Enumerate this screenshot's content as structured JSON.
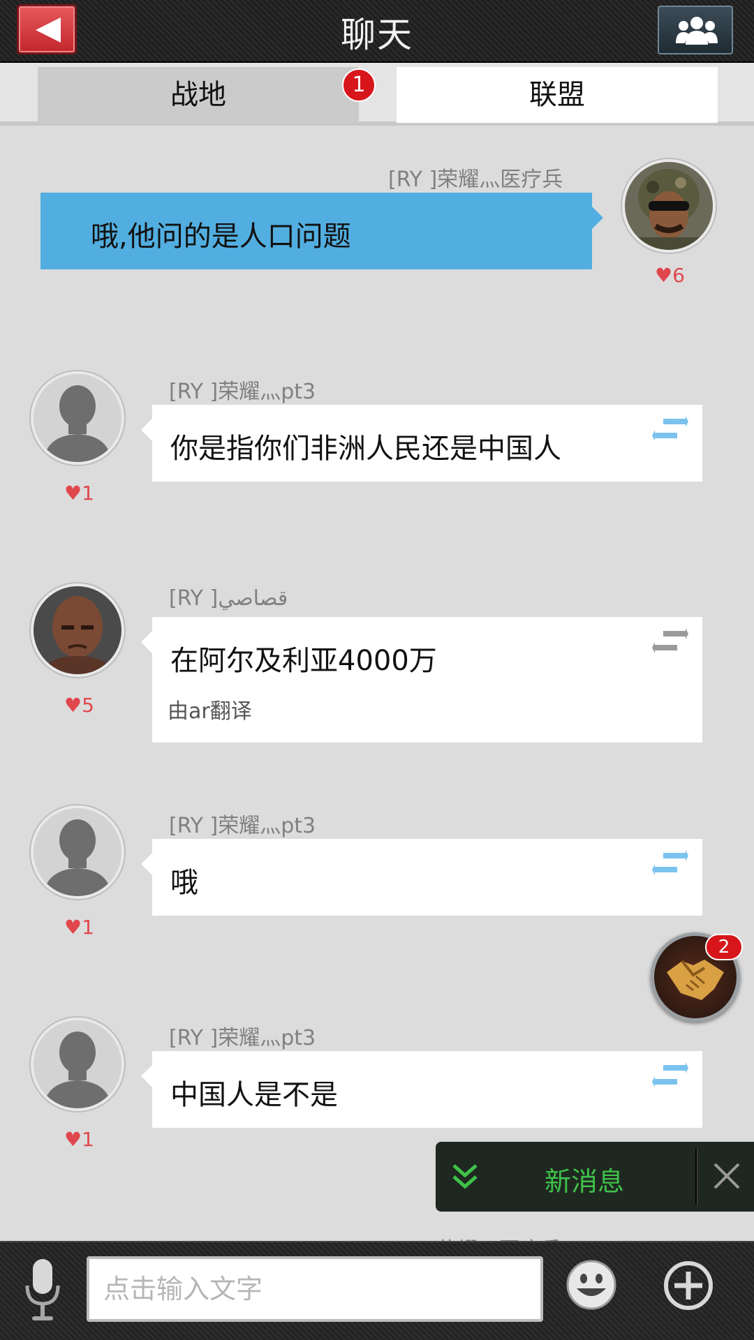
{
  "header": {
    "title": "聊天",
    "back_icon": "back-arrow-icon",
    "group_icon": "group-people-icon"
  },
  "tabs": [
    {
      "label": "战地",
      "badge": "1",
      "active": false
    },
    {
      "label": "联盟",
      "active": true
    }
  ],
  "messages": [
    {
      "sender": "[RY ]荣耀灬医疗兵",
      "text": "哦,他问的是人口问题",
      "likes": "6",
      "mine": true,
      "avatar": "soldier-avatar"
    },
    {
      "sender": "[RY ]荣耀灬pt3",
      "text": "你是指你们非洲人民还是中国人",
      "likes": "1",
      "avatar": "default-silhouette-avatar"
    },
    {
      "sender": "[RY ]قصاصي",
      "text": "在阿尔及利亚4000万",
      "sub": "由ar翻译",
      "likes": "5",
      "avatar": "bald-man-avatar"
    },
    {
      "sender": "[RY ]荣耀灬pt3",
      "text": "哦",
      "likes": "1",
      "avatar": "default-silhouette-avatar"
    },
    {
      "sender": "[RY ]荣耀灬pt3",
      "text": "中国人是不是",
      "likes": "1",
      "avatar": "default-silhouette-avatar"
    }
  ],
  "peek_message": {
    "sender": "[RY ]荣耀灬医疗兵"
  },
  "heart_glyph": "♥",
  "alliance_button": {
    "icon": "handshake-icon",
    "badge": "2"
  },
  "toast": {
    "text": "新消息",
    "icon": "double-chevron-down-icon",
    "close_icon": "close-icon"
  },
  "input": {
    "placeholder": "点击输入文字",
    "value": ""
  },
  "colors": {
    "accent_blue": "#52aee0",
    "badge_red": "#d7161b",
    "toast_green": "#3fc24a",
    "heart": "#e0474d"
  }
}
